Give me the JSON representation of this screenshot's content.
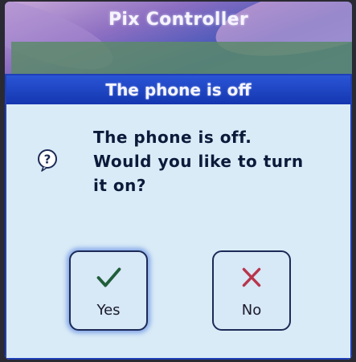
{
  "app": {
    "title": "Pix Controller"
  },
  "dialog": {
    "title": "The phone is off",
    "message_lines": [
      "The phone is off.",
      "Would you like to turn",
      "it on?"
    ],
    "icon": "help-question-icon",
    "buttons": {
      "yes": {
        "label": "Yes",
        "icon": "checkmark-icon",
        "color": "#1f5e3a"
      },
      "no": {
        "label": "No",
        "icon": "x-mark-icon",
        "color": "#b8354c"
      }
    }
  },
  "colors": {
    "header_blue": "#1436b0",
    "dialog_bg": "#d9ebf7"
  }
}
